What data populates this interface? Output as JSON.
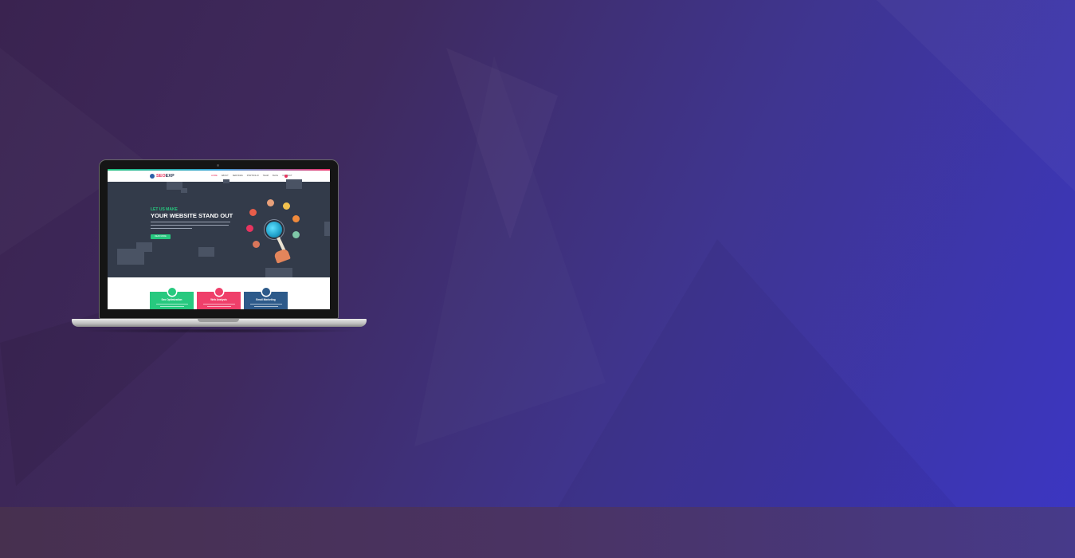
{
  "colors": {
    "background_start": "#3a2350",
    "background_end": "#3b36c4",
    "site_green": "#27c97f",
    "site_pink": "#e8345f",
    "site_navy": "#2d5a8a",
    "hero_bg": "#333b4a"
  },
  "site": {
    "logo_seo": "SEO",
    "logo_exp": "EXP",
    "menu": [
      "HOME",
      "ABOUT",
      "SERVICES",
      "PORTFOLIO",
      "TEAM",
      "BLOG",
      "CONTACT"
    ],
    "hero_kicker": "LET US MAKE",
    "hero_title": "YOUR WEBSITE STAND OUT",
    "hero_button": "READ MORE",
    "cards": [
      {
        "title": "Seo Optimization"
      },
      {
        "title": "Web Analysis"
      },
      {
        "title": "Email Marketing"
      }
    ]
  }
}
